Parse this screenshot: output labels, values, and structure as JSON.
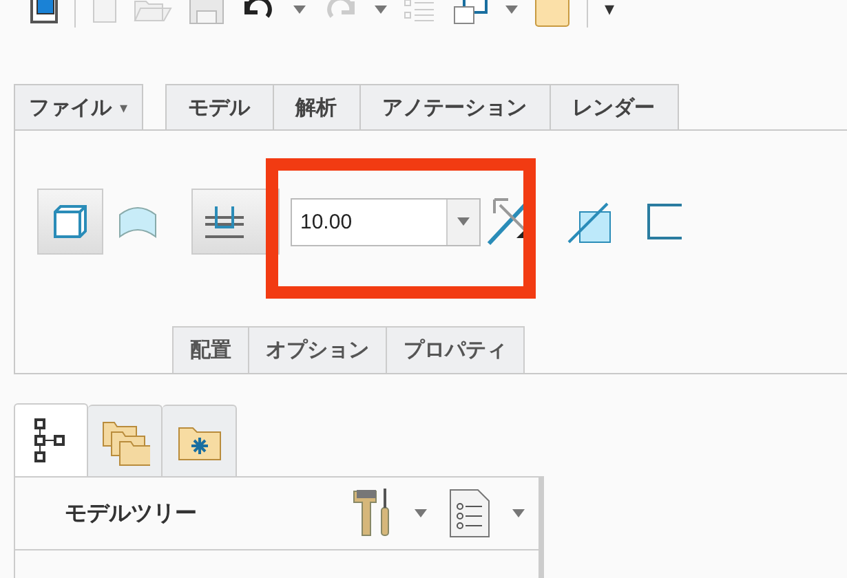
{
  "quick_toolbar": {
    "overflow": "▾"
  },
  "ribbon_tabs": [
    {
      "label": "ファイル",
      "kind": "menu",
      "selected": false,
      "caret": "▾"
    },
    {
      "label": "モデル",
      "kind": "tab",
      "selected": false
    },
    {
      "label": "解析",
      "kind": "tab",
      "selected": false
    },
    {
      "label": "アノテーション",
      "kind": "tab",
      "selected": false
    },
    {
      "label": "レンダー",
      "kind": "tab",
      "selected": false
    }
  ],
  "ribbon": {
    "value_field": {
      "value": "10.00"
    },
    "highlighted": true,
    "sub_tabs": [
      {
        "label": "配置"
      },
      {
        "label": "オプション"
      },
      {
        "label": "プロパティ"
      }
    ]
  },
  "navigator_tabs": [
    {
      "kind": "tree",
      "selected": true
    },
    {
      "kind": "folders",
      "selected": false
    },
    {
      "kind": "favorites",
      "selected": false
    }
  ],
  "model_tree": {
    "title": "モデルツリー"
  }
}
